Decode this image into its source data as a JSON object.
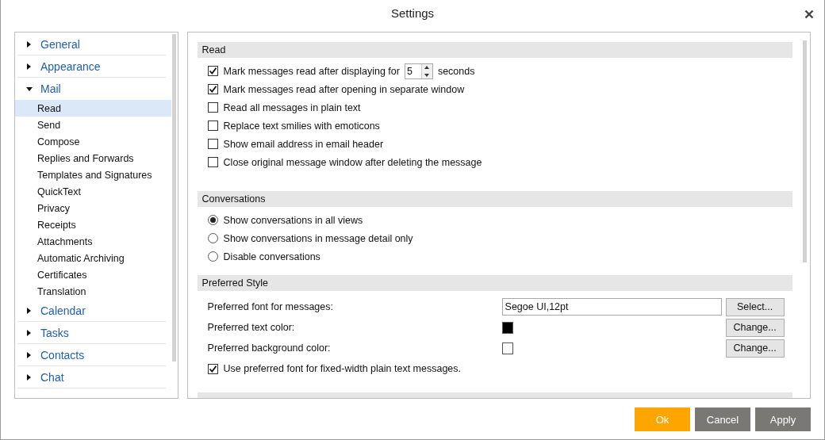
{
  "window": {
    "title": "Settings"
  },
  "sidebar": {
    "groups": [
      {
        "label": "General",
        "expanded": false
      },
      {
        "label": "Appearance",
        "expanded": false
      },
      {
        "label": "Mail",
        "expanded": true,
        "children": [
          {
            "label": "Read",
            "selected": true
          },
          {
            "label": "Send",
            "selected": false
          },
          {
            "label": "Compose",
            "selected": false
          },
          {
            "label": "Replies and Forwards",
            "selected": false
          },
          {
            "label": "Templates and Signatures",
            "selected": false
          },
          {
            "label": "QuickText",
            "selected": false
          },
          {
            "label": "Privacy",
            "selected": false
          },
          {
            "label": "Receipts",
            "selected": false
          },
          {
            "label": "Attachments",
            "selected": false
          },
          {
            "label": "Automatic Archiving",
            "selected": false
          },
          {
            "label": "Certificates",
            "selected": false
          },
          {
            "label": "Translation",
            "selected": false
          }
        ]
      },
      {
        "label": "Calendar",
        "expanded": false
      },
      {
        "label": "Tasks",
        "expanded": false
      },
      {
        "label": "Contacts",
        "expanded": false
      },
      {
        "label": "Chat",
        "expanded": false
      }
    ]
  },
  "sections": [
    {
      "title": "Read",
      "options": [
        {
          "kind": "checkbox",
          "label": "Mark messages read after displaying for",
          "checked": true,
          "spinner": "5",
          "suffix": "seconds"
        },
        {
          "kind": "checkbox",
          "label": "Mark messages read after opening in separate window",
          "checked": true
        },
        {
          "kind": "checkbox",
          "label": "Read all messages in plain text",
          "checked": false
        },
        {
          "kind": "checkbox",
          "label": "Replace text smilies with emoticons",
          "checked": false
        },
        {
          "kind": "checkbox",
          "label": "Show email address in email header",
          "checked": false
        },
        {
          "kind": "checkbox",
          "label": "Close original message window after deleting the message",
          "checked": false
        }
      ]
    },
    {
      "title": "Conversations",
      "options": [
        {
          "kind": "radio",
          "label": "Show conversations in all views",
          "selected": true
        },
        {
          "kind": "radio",
          "label": "Show conversations in message detail only",
          "selected": false
        },
        {
          "kind": "radio",
          "label": "Disable conversations",
          "selected": false
        }
      ]
    },
    {
      "title": "Preferred Style",
      "options": [
        {
          "kind": "font",
          "label": "Preferred font for messages:",
          "value": "Segoe UI,12pt",
          "button": "Select..."
        },
        {
          "kind": "color",
          "label": "Preferred text color:",
          "color": "#000000",
          "button": "Change..."
        },
        {
          "kind": "color",
          "label": "Preferred background color:",
          "color": "#ffffff",
          "button": "Change..."
        },
        {
          "kind": "checkbox",
          "label": "Use preferred font for fixed-width plain text messages.",
          "checked": true
        }
      ]
    }
  ],
  "footer": {
    "buttons": [
      {
        "label": "Ok",
        "kind": "primary"
      },
      {
        "label": "Cancel",
        "kind": "secondary"
      },
      {
        "label": "Apply",
        "kind": "secondary"
      }
    ]
  }
}
